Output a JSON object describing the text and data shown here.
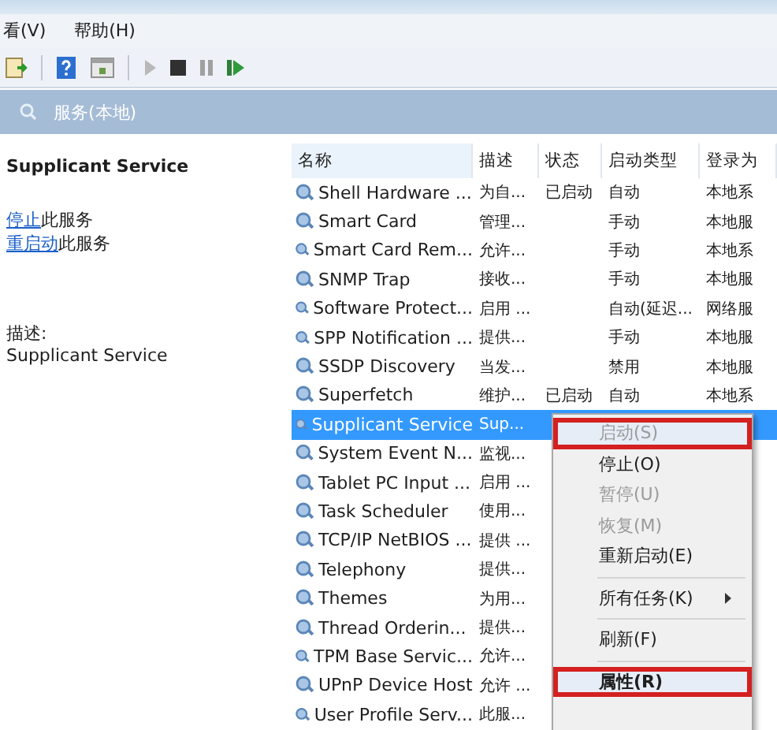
{
  "menu_bar": [
    {
      "label": "看(V)"
    },
    {
      "label": "帮助(H)"
    }
  ],
  "header": {
    "title": "服务(本地)"
  },
  "detail": {
    "title": "Supplicant Service",
    "actions": [
      {
        "link": "停止",
        "text": "此服务"
      },
      {
        "link": "重启动",
        "text": "此服务"
      }
    ],
    "description_label": "描述:",
    "description": "Supplicant Service"
  },
  "table": {
    "columns": [
      "名称",
      "描述",
      "状态",
      "启动类型",
      "登录为"
    ],
    "rows": [
      {
        "name": "Shell Hardware ...",
        "desc": "为自...",
        "status": "已启动",
        "start": "自动",
        "login": "本地系",
        "selected": false
      },
      {
        "name": "Smart Card",
        "desc": "管理...",
        "status": "",
        "start": "手动",
        "login": "本地服",
        "selected": false
      },
      {
        "name": "Smart Card Rem...",
        "desc": "允许...",
        "status": "",
        "start": "手动",
        "login": "本地系",
        "selected": false
      },
      {
        "name": "SNMP Trap",
        "desc": "接收...",
        "status": "",
        "start": "手动",
        "login": "本地服",
        "selected": false
      },
      {
        "name": "Software Protect...",
        "desc": "启用 ...",
        "status": "",
        "start": "自动(延迟...",
        "login": "网络服",
        "selected": false
      },
      {
        "name": "SPP Notification ...",
        "desc": "提供...",
        "status": "",
        "start": "手动",
        "login": "本地服",
        "selected": false
      },
      {
        "name": "SSDP Discovery",
        "desc": "当发...",
        "status": "",
        "start": "禁用",
        "login": "本地服",
        "selected": false
      },
      {
        "name": "Superfetch",
        "desc": "维护...",
        "status": "已启动",
        "start": "自动",
        "login": "本地系",
        "selected": false
      },
      {
        "name": "Supplicant Service",
        "desc": "Sup...",
        "selected": true
      },
      {
        "name": "System Event N...",
        "desc": "监视...",
        "selected": false
      },
      {
        "name": "Tablet PC Input ...",
        "desc": "启用 ...",
        "selected": false
      },
      {
        "name": "Task Scheduler",
        "desc": "使用...",
        "selected": false
      },
      {
        "name": "TCP/IP NetBIOS ...",
        "desc": "提供 ...",
        "selected": false
      },
      {
        "name": "Telephony",
        "desc": "提供...",
        "selected": false
      },
      {
        "name": "Themes",
        "desc": "为用...",
        "selected": false
      },
      {
        "name": "Thread Orderin...",
        "desc": "提供...",
        "selected": false
      },
      {
        "name": "TPM Base Servic...",
        "desc": "允许...",
        "selected": false
      },
      {
        "name": "UPnP Device Host",
        "desc": "允许 ...",
        "selected": false
      },
      {
        "name": "User Profile Serv...",
        "desc": "此服...",
        "selected": false
      }
    ]
  },
  "context_menu": [
    {
      "kind": "item",
      "label": "启动(S)",
      "disabled": true,
      "highlighted": true
    },
    {
      "kind": "item",
      "label": "停止(O)",
      "disabled": false,
      "highlighted": false
    },
    {
      "kind": "item",
      "label": "暂停(U)",
      "disabled": true,
      "highlighted": false
    },
    {
      "kind": "item",
      "label": "恢复(M)",
      "disabled": true,
      "highlighted": false
    },
    {
      "kind": "item",
      "label": "重新启动(E)",
      "disabled": false,
      "highlighted": false
    },
    {
      "kind": "separator"
    },
    {
      "kind": "submenu",
      "label": "所有任务(K)",
      "disabled": false,
      "highlighted": false
    },
    {
      "kind": "separator"
    },
    {
      "kind": "item",
      "label": "刷新(F)",
      "disabled": false,
      "highlighted": false
    },
    {
      "kind": "separator"
    },
    {
      "kind": "default",
      "label": "属性(R)",
      "disabled": false,
      "highlighted": true
    }
  ]
}
